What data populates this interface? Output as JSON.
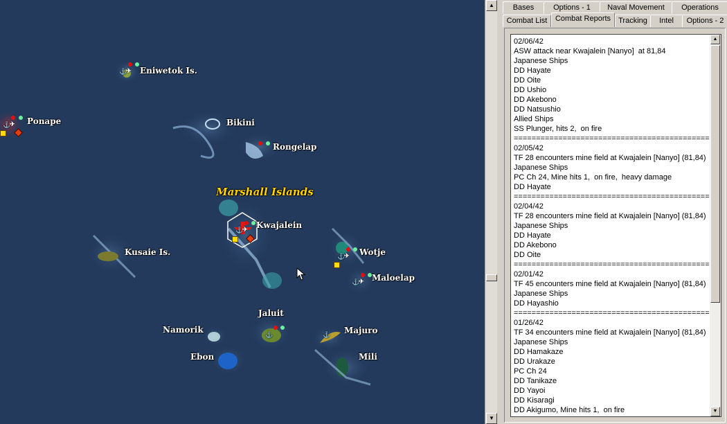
{
  "map": {
    "region_title": "Marshall Islands",
    "places": {
      "eniwetok": "Eniwetok Is.",
      "ponape": "Ponape",
      "bikini": "Bikini",
      "rongelap": "Rongelap",
      "kwajalein": "Kwajalein",
      "kusaie": "Kusaie Is.",
      "wotje": "Wotje",
      "maloelap": "Maloelap",
      "jaluit": "Jaluit",
      "namorik": "Namorik",
      "majuro": "Majuro",
      "ebon": "Ebon",
      "mili": "Mili"
    },
    "icons": {
      "port": "anchor-icon",
      "airfield": "plane-icon",
      "cursor": "mouse-pointer-icon"
    },
    "colors": {
      "sea": "#233a5c",
      "title": "#ffd400",
      "enemy": "#e01010",
      "friendly": "#6ff0a0",
      "supply": "#ffdd00"
    }
  },
  "tabs": {
    "row1": [
      "Bases",
      "Options - 1",
      "Naval Movement",
      "Operations"
    ],
    "row2": [
      "Combat List",
      "Combat Reports",
      "Tracking",
      "Intel",
      "Options - 2"
    ],
    "active": "Combat Reports"
  },
  "report": {
    "lines": [
      "02/06/42",
      "ASW attack near Kwajalein [Nanyo]  at 81,84",
      "Japanese Ships",
      "DD Hayate",
      "DD Oite",
      "DD Ushio",
      "DD Akebono",
      "DD Natsushio",
      "Allied Ships",
      "SS Plunger, hits 2,  on fire",
      "================================================",
      "02/05/42",
      "TF 28 encounters mine field at Kwajalein [Nanyo] (81,84)",
      "Japanese Ships",
      "PC Ch 24, Mine hits 1,  on fire,  heavy damage",
      "DD Hayate",
      "================================================",
      "02/04/42",
      "TF 28 encounters mine field at Kwajalein [Nanyo] (81,84)",
      "Japanese Ships",
      "DD Hayate",
      "DD Akebono",
      "DD Oite",
      "================================================",
      "02/01/42",
      "TF 45 encounters mine field at Kwajalein [Nanyo] (81,84)",
      "Japanese Ships",
      "DD Hayashio",
      "================================================",
      "01/26/42",
      "TF 34 encounters mine field at Kwajalein [Nanyo] (81,84)",
      "Japanese Ships",
      "DD Hamakaze",
      "DD Urakaze",
      "PC Ch 24",
      "DD Tanikaze",
      "DD Yayoi",
      "DD Kisaragi",
      "DD Akigumo, Mine hits 1,  on fire"
    ]
  }
}
